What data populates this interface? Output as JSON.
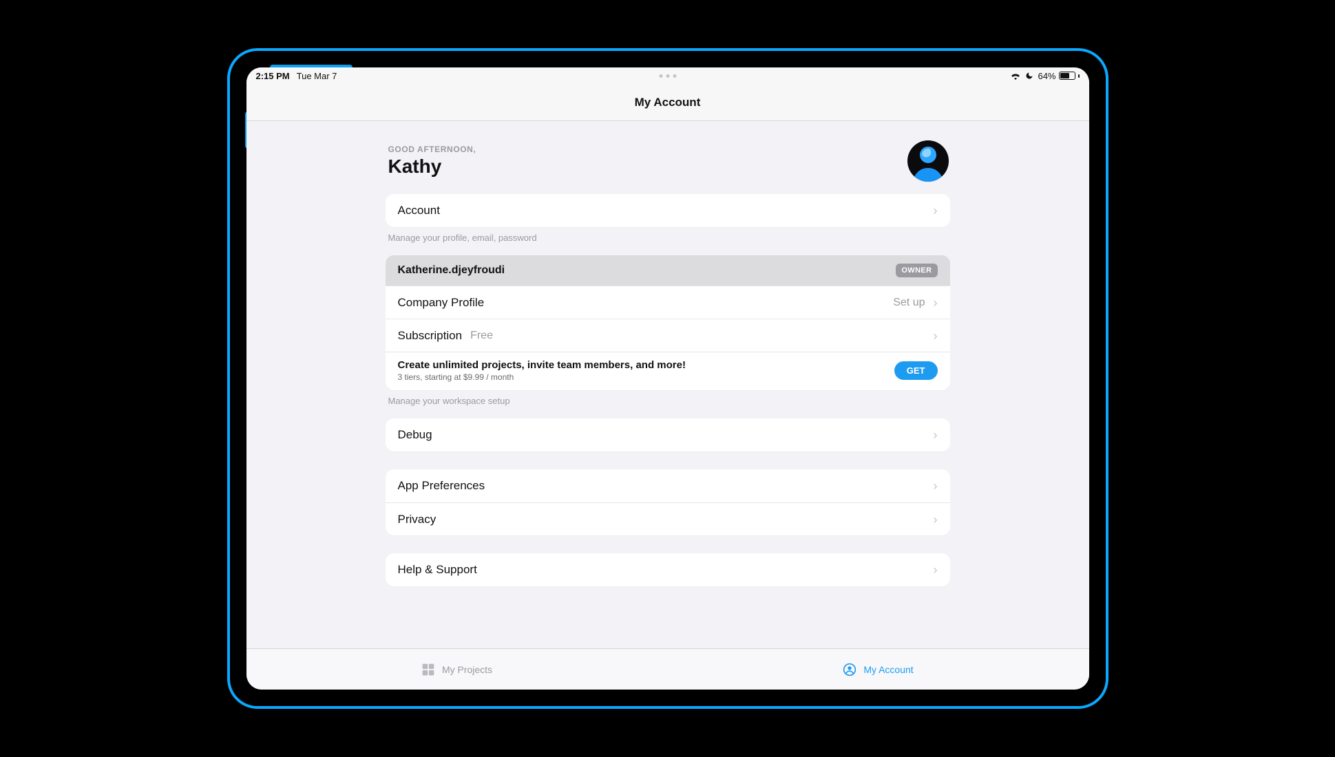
{
  "statusbar": {
    "time": "2:15 PM",
    "date": "Tue Mar 7",
    "battery_pct": "64%"
  },
  "navbar": {
    "title": "My Account"
  },
  "hero": {
    "greeting": "GOOD AFTERNOON,",
    "name": "Kathy"
  },
  "account": {
    "label": "Account",
    "footnote": "Manage your profile, email, password"
  },
  "workspace": {
    "name": "Katherine.djeyfroudi",
    "badge": "OWNER",
    "company_profile": {
      "label": "Company Profile",
      "action": "Set up"
    },
    "subscription": {
      "label": "Subscription",
      "value": "Free"
    },
    "promo": {
      "title": "Create unlimited projects, invite team members, and more!",
      "subtitle": "3 tiers, starting at $9.99 / month",
      "cta": "GET"
    },
    "footnote": "Manage your workspace setup"
  },
  "debug": {
    "label": "Debug"
  },
  "prefs": {
    "app_preferences": "App Preferences",
    "privacy": "Privacy"
  },
  "help": {
    "label": "Help & Support"
  },
  "tabbar": {
    "projects": "My Projects",
    "account": "My Account"
  }
}
